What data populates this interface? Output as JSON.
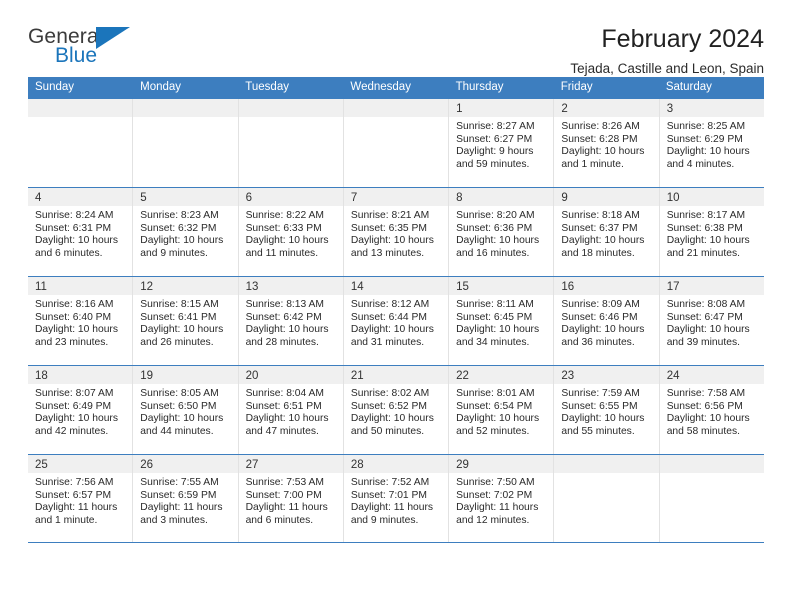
{
  "brand": {
    "name_top": "General",
    "name_bottom": "Blue",
    "accent_color": "#1b75bb"
  },
  "header": {
    "title": "February 2024",
    "subtitle": "Tejada, Castille and Leon, Spain"
  },
  "calendar": {
    "header_bg": "#3d7ebf",
    "daynum_band_bg": "#f0f0f0",
    "weekdays": [
      "Sunday",
      "Monday",
      "Tuesday",
      "Wednesday",
      "Thursday",
      "Friday",
      "Saturday"
    ],
    "weeks": [
      [
        {
          "day": "",
          "sunrise": "",
          "sunset": "",
          "daylight1": "",
          "daylight2": ""
        },
        {
          "day": "",
          "sunrise": "",
          "sunset": "",
          "daylight1": "",
          "daylight2": ""
        },
        {
          "day": "",
          "sunrise": "",
          "sunset": "",
          "daylight1": "",
          "daylight2": ""
        },
        {
          "day": "",
          "sunrise": "",
          "sunset": "",
          "daylight1": "",
          "daylight2": ""
        },
        {
          "day": "1",
          "sunrise": "Sunrise: 8:27 AM",
          "sunset": "Sunset: 6:27 PM",
          "daylight1": "Daylight: 9 hours",
          "daylight2": "and 59 minutes."
        },
        {
          "day": "2",
          "sunrise": "Sunrise: 8:26 AM",
          "sunset": "Sunset: 6:28 PM",
          "daylight1": "Daylight: 10 hours",
          "daylight2": "and 1 minute."
        },
        {
          "day": "3",
          "sunrise": "Sunrise: 8:25 AM",
          "sunset": "Sunset: 6:29 PM",
          "daylight1": "Daylight: 10 hours",
          "daylight2": "and 4 minutes."
        }
      ],
      [
        {
          "day": "4",
          "sunrise": "Sunrise: 8:24 AM",
          "sunset": "Sunset: 6:31 PM",
          "daylight1": "Daylight: 10 hours",
          "daylight2": "and 6 minutes."
        },
        {
          "day": "5",
          "sunrise": "Sunrise: 8:23 AM",
          "sunset": "Sunset: 6:32 PM",
          "daylight1": "Daylight: 10 hours",
          "daylight2": "and 9 minutes."
        },
        {
          "day": "6",
          "sunrise": "Sunrise: 8:22 AM",
          "sunset": "Sunset: 6:33 PM",
          "daylight1": "Daylight: 10 hours",
          "daylight2": "and 11 minutes."
        },
        {
          "day": "7",
          "sunrise": "Sunrise: 8:21 AM",
          "sunset": "Sunset: 6:35 PM",
          "daylight1": "Daylight: 10 hours",
          "daylight2": "and 13 minutes."
        },
        {
          "day": "8",
          "sunrise": "Sunrise: 8:20 AM",
          "sunset": "Sunset: 6:36 PM",
          "daylight1": "Daylight: 10 hours",
          "daylight2": "and 16 minutes."
        },
        {
          "day": "9",
          "sunrise": "Sunrise: 8:18 AM",
          "sunset": "Sunset: 6:37 PM",
          "daylight1": "Daylight: 10 hours",
          "daylight2": "and 18 minutes."
        },
        {
          "day": "10",
          "sunrise": "Sunrise: 8:17 AM",
          "sunset": "Sunset: 6:38 PM",
          "daylight1": "Daylight: 10 hours",
          "daylight2": "and 21 minutes."
        }
      ],
      [
        {
          "day": "11",
          "sunrise": "Sunrise: 8:16 AM",
          "sunset": "Sunset: 6:40 PM",
          "daylight1": "Daylight: 10 hours",
          "daylight2": "and 23 minutes."
        },
        {
          "day": "12",
          "sunrise": "Sunrise: 8:15 AM",
          "sunset": "Sunset: 6:41 PM",
          "daylight1": "Daylight: 10 hours",
          "daylight2": "and 26 minutes."
        },
        {
          "day": "13",
          "sunrise": "Sunrise: 8:13 AM",
          "sunset": "Sunset: 6:42 PM",
          "daylight1": "Daylight: 10 hours",
          "daylight2": "and 28 minutes."
        },
        {
          "day": "14",
          "sunrise": "Sunrise: 8:12 AM",
          "sunset": "Sunset: 6:44 PM",
          "daylight1": "Daylight: 10 hours",
          "daylight2": "and 31 minutes."
        },
        {
          "day": "15",
          "sunrise": "Sunrise: 8:11 AM",
          "sunset": "Sunset: 6:45 PM",
          "daylight1": "Daylight: 10 hours",
          "daylight2": "and 34 minutes."
        },
        {
          "day": "16",
          "sunrise": "Sunrise: 8:09 AM",
          "sunset": "Sunset: 6:46 PM",
          "daylight1": "Daylight: 10 hours",
          "daylight2": "and 36 minutes."
        },
        {
          "day": "17",
          "sunrise": "Sunrise: 8:08 AM",
          "sunset": "Sunset: 6:47 PM",
          "daylight1": "Daylight: 10 hours",
          "daylight2": "and 39 minutes."
        }
      ],
      [
        {
          "day": "18",
          "sunrise": "Sunrise: 8:07 AM",
          "sunset": "Sunset: 6:49 PM",
          "daylight1": "Daylight: 10 hours",
          "daylight2": "and 42 minutes."
        },
        {
          "day": "19",
          "sunrise": "Sunrise: 8:05 AM",
          "sunset": "Sunset: 6:50 PM",
          "daylight1": "Daylight: 10 hours",
          "daylight2": "and 44 minutes."
        },
        {
          "day": "20",
          "sunrise": "Sunrise: 8:04 AM",
          "sunset": "Sunset: 6:51 PM",
          "daylight1": "Daylight: 10 hours",
          "daylight2": "and 47 minutes."
        },
        {
          "day": "21",
          "sunrise": "Sunrise: 8:02 AM",
          "sunset": "Sunset: 6:52 PM",
          "daylight1": "Daylight: 10 hours",
          "daylight2": "and 50 minutes."
        },
        {
          "day": "22",
          "sunrise": "Sunrise: 8:01 AM",
          "sunset": "Sunset: 6:54 PM",
          "daylight1": "Daylight: 10 hours",
          "daylight2": "and 52 minutes."
        },
        {
          "day": "23",
          "sunrise": "Sunrise: 7:59 AM",
          "sunset": "Sunset: 6:55 PM",
          "daylight1": "Daylight: 10 hours",
          "daylight2": "and 55 minutes."
        },
        {
          "day": "24",
          "sunrise": "Sunrise: 7:58 AM",
          "sunset": "Sunset: 6:56 PM",
          "daylight1": "Daylight: 10 hours",
          "daylight2": "and 58 minutes."
        }
      ],
      [
        {
          "day": "25",
          "sunrise": "Sunrise: 7:56 AM",
          "sunset": "Sunset: 6:57 PM",
          "daylight1": "Daylight: 11 hours",
          "daylight2": "and 1 minute."
        },
        {
          "day": "26",
          "sunrise": "Sunrise: 7:55 AM",
          "sunset": "Sunset: 6:59 PM",
          "daylight1": "Daylight: 11 hours",
          "daylight2": "and 3 minutes."
        },
        {
          "day": "27",
          "sunrise": "Sunrise: 7:53 AM",
          "sunset": "Sunset: 7:00 PM",
          "daylight1": "Daylight: 11 hours",
          "daylight2": "and 6 minutes."
        },
        {
          "day": "28",
          "sunrise": "Sunrise: 7:52 AM",
          "sunset": "Sunset: 7:01 PM",
          "daylight1": "Daylight: 11 hours",
          "daylight2": "and 9 minutes."
        },
        {
          "day": "29",
          "sunrise": "Sunrise: 7:50 AM",
          "sunset": "Sunset: 7:02 PM",
          "daylight1": "Daylight: 11 hours",
          "daylight2": "and 12 minutes."
        },
        {
          "day": "",
          "sunrise": "",
          "sunset": "",
          "daylight1": "",
          "daylight2": ""
        },
        {
          "day": "",
          "sunrise": "",
          "sunset": "",
          "daylight1": "",
          "daylight2": ""
        }
      ]
    ]
  }
}
